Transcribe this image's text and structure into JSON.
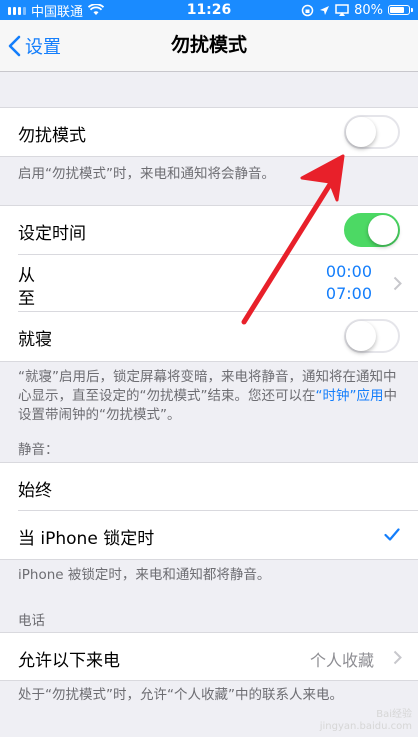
{
  "status_bar": {
    "carrier": "中国联通",
    "time": "11:26",
    "battery": "80%"
  },
  "nav": {
    "back_label": "设置",
    "title": "勿扰模式"
  },
  "dnd": {
    "label": "勿扰模式",
    "enabled": false,
    "footer": "启用“勿扰模式”时，来电和通知将会静音。"
  },
  "scheduled": {
    "label": "设定时间",
    "enabled": true,
    "from_label": "从",
    "to_label": "至",
    "from_time": "00:00",
    "to_time": "07:00"
  },
  "bedtime": {
    "label": "就寝",
    "enabled": false,
    "footer_part1": "“就寝”启用后，锁定屏幕将变暗，来电将静音，通知将在通知中心显示，直至设定的“勿扰模式”结束。您还可以在",
    "footer_link": "“时钟”应用",
    "footer_part2": "中设置带闹钟的“勿扰模式”。"
  },
  "silence": {
    "header": "静音：",
    "always_label": "始终",
    "locked_label": "当 iPhone 锁定时",
    "footer": "iPhone 被锁定时，来电和通知都将静音。"
  },
  "phone": {
    "header": "电话",
    "allow_calls_label": "允许以下来电",
    "allow_calls_value": "个人收藏",
    "footer": "处于“勿扰模式”时，允许“个人收藏”中的联系人来电。"
  },
  "watermark": {
    "line1": "Bai经验",
    "line2": "jingyan.baidu.com"
  },
  "colors": {
    "accent": "#147efb",
    "toggle_on": "#4cd964",
    "status_bar": "#1a8bff",
    "annotation_arrow": "#e8202a"
  }
}
